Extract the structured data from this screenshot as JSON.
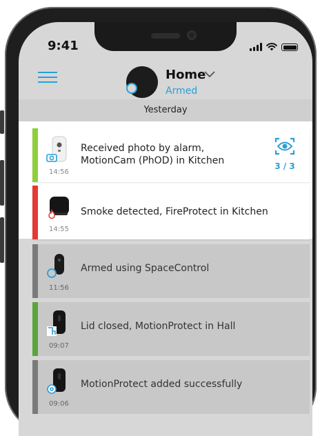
{
  "status_bar": {
    "time": "9:41"
  },
  "header": {
    "hub_name": "Home",
    "hub_state": "Armed"
  },
  "divider": {
    "date_label": "Yesterday"
  },
  "events": [
    {
      "text_line1": "Received photo by alarm,",
      "text_line2": "MotionCam (PhOD) in Kitchen",
      "time": "14:56",
      "stripe_color": "#8fcf3c",
      "device_icon": "motioncam-icon",
      "badge_icon": "camera-icon",
      "photo_count": "3 / 3"
    },
    {
      "text_line1": "Smoke detected, FireProtect in Kitchen",
      "time": "14:55",
      "stripe_color": "#e53935",
      "device_icon": "fireprotect-icon",
      "badge_icon": "fire-icon"
    },
    {
      "text_line1": "Armed using SpaceControl",
      "time": "11:56",
      "stripe_color": "#7a7a7a",
      "device_icon": "spacecontrol-icon",
      "badge_icon": "armed-icon"
    },
    {
      "text_line1": "Lid closed, MotionProtect in Hall",
      "time": "09:07",
      "stripe_color": "#5aa63b",
      "device_icon": "motionprotect-icon",
      "badge_icon": "lid-icon"
    },
    {
      "text_line1": "MotionProtect added successfully",
      "time": "09:06",
      "stripe_color": "#7a7a7a",
      "device_icon": "motionprotect-icon",
      "badge_icon": "settings-icon"
    }
  ],
  "colors": {
    "accent": "#2a9fd6",
    "alarm_red": "#e53935",
    "ok_green": "#8fcf3c"
  }
}
